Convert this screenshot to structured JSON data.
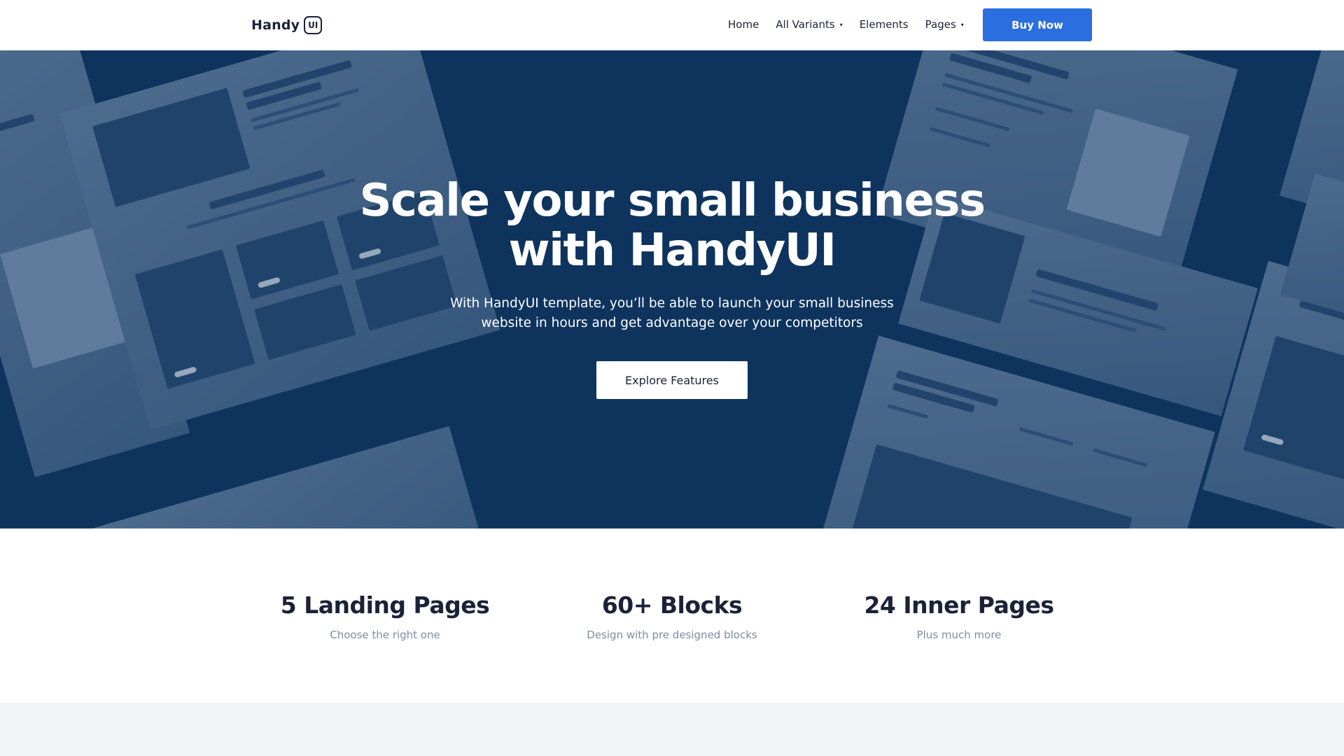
{
  "nav": {
    "logo_text": "Handy",
    "logo_mark": "UI",
    "items": [
      {
        "label": "Home",
        "has_dropdown": false
      },
      {
        "label": "All Variants",
        "has_dropdown": true
      },
      {
        "label": "Elements",
        "has_dropdown": false
      },
      {
        "label": "Pages",
        "has_dropdown": true
      }
    ],
    "caret_glyph": "▾",
    "buy_label": "Buy Now"
  },
  "hero": {
    "title_line1": "Scale your small business",
    "title_line2": "with HandyUI",
    "subtitle_line1": "With HandyUI template, you’ll be able to launch your small business",
    "subtitle_line2": "website in hours and get advantage over your competitors",
    "cta_label": "Explore Features"
  },
  "stats": [
    {
      "value": "5 Landing Pages",
      "caption": "Choose the right one"
    },
    {
      "value": "60+ Blocks",
      "caption": "Design with pre designed blocks"
    },
    {
      "value": "24 Inner Pages",
      "caption": "Plus much more"
    }
  ],
  "colors": {
    "accent": "#2a6ee0",
    "hero_bg": "#0f355f",
    "text_dark": "#1b2238",
    "text_muted": "#7f8ca3",
    "section_alt": "#f0f4f6"
  }
}
